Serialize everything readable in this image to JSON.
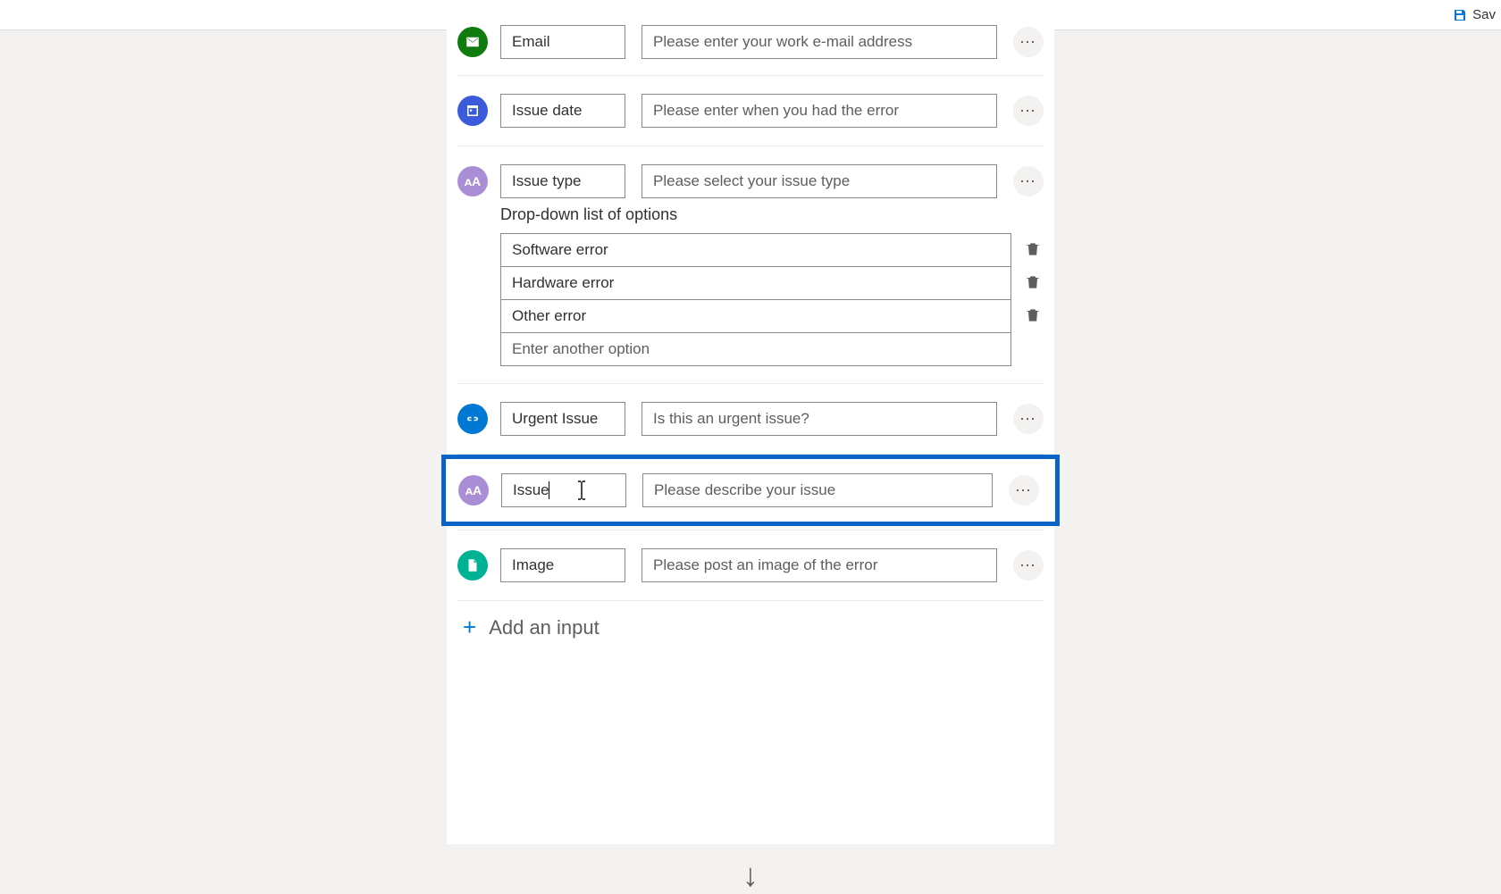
{
  "topbar": {
    "save_label": "Sav"
  },
  "rows": {
    "email": {
      "name": "Email",
      "desc": "Please enter your work e-mail address"
    },
    "date": {
      "name": "Issue date",
      "desc": "Please enter when you had the error"
    },
    "type": {
      "name": "Issue type",
      "desc": "Please select your issue type"
    },
    "urgent": {
      "name": "Urgent Issue",
      "desc": "Is this an urgent issue?"
    },
    "issue": {
      "name": "Issue",
      "desc": "Please describe your issue"
    },
    "image": {
      "name": "Image",
      "desc": "Please post an image of the error"
    }
  },
  "dropdown": {
    "label": "Drop-down list of options",
    "options": [
      "Software error",
      "Hardware error",
      "Other error"
    ],
    "placeholder": "Enter another option"
  },
  "add_input_label": "Add an input"
}
